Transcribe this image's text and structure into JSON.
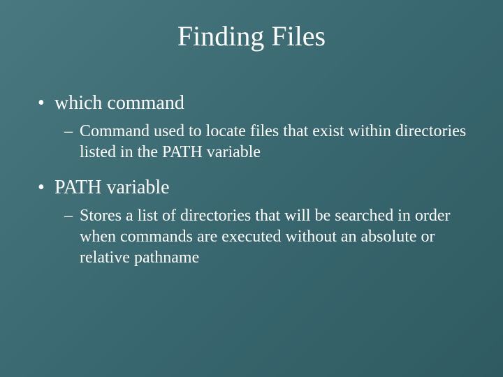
{
  "slide": {
    "title": "Finding Files",
    "bullets": [
      {
        "label": "which command",
        "sub": [
          "Command used to locate files that exist within directories listed in the PATH variable"
        ]
      },
      {
        "label": "PATH variable",
        "sub": [
          "Stores a list of directories that will be searched in order when commands are executed without an absolute or relative pathname"
        ]
      }
    ]
  }
}
